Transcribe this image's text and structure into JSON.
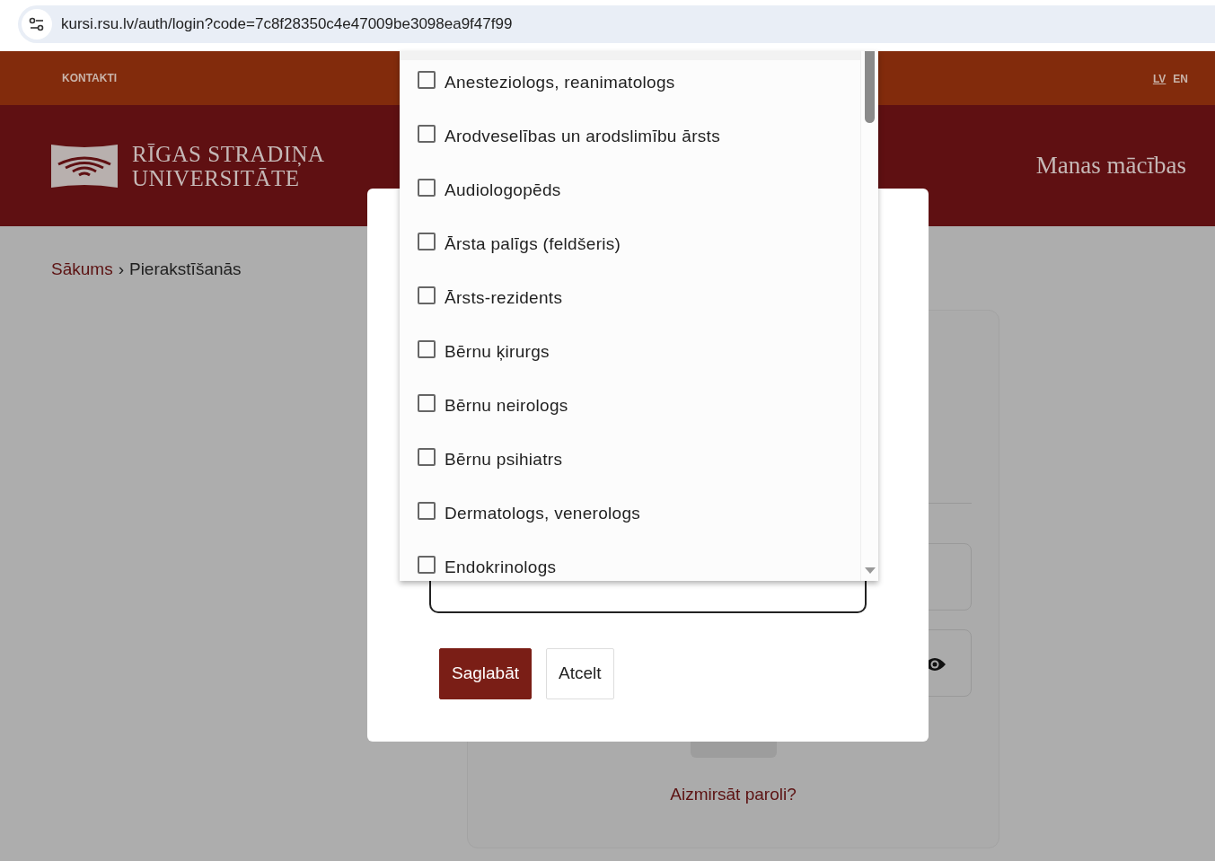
{
  "browser": {
    "url": "kursi.rsu.lv/auth/login?code=7c8f28350c4e47009be3098ea9f47f99"
  },
  "top_bar": {
    "links": [
      "KONTAKTI"
    ],
    "languages": [
      {
        "label": "LV",
        "selected": true
      },
      {
        "label": "EN",
        "selected": false
      }
    ]
  },
  "header": {
    "logo_lines": [
      "RĪGAS STRADIŅA",
      "UNIVERSITĀTE"
    ],
    "title": "Manas mācības"
  },
  "breadcrumb": {
    "items": [
      {
        "label": "Sākums",
        "link": true
      },
      {
        "label": "Pierakstīšanās",
        "link": false
      }
    ],
    "separator": "›"
  },
  "login_card": {
    "forgot_link": "Aizmirsāt paroli?"
  },
  "modal": {
    "buttons": [
      {
        "label": "Saglabāt",
        "kind": "primary"
      },
      {
        "label": "Atcelt",
        "kind": "secondary"
      }
    ]
  },
  "dropdown": {
    "options": [
      {
        "label": "Anesteziologs, reanimatologs",
        "checked": false
      },
      {
        "label": "Arodveselības un arodslimību ārsts",
        "checked": false
      },
      {
        "label": "Audiologopēds",
        "checked": false
      },
      {
        "label": "Ārsta palīgs (feldšeris)",
        "checked": false
      },
      {
        "label": "Ārsts-rezidents",
        "checked": false
      },
      {
        "label": "Bērnu ķirurgs",
        "checked": false
      },
      {
        "label": "Bērnu neirologs",
        "checked": false
      },
      {
        "label": "Bērnu psihiatrs",
        "checked": false
      },
      {
        "label": "Dermatologs, venerologs",
        "checked": false
      },
      {
        "label": "Endokrinologs",
        "checked": false
      }
    ]
  }
}
